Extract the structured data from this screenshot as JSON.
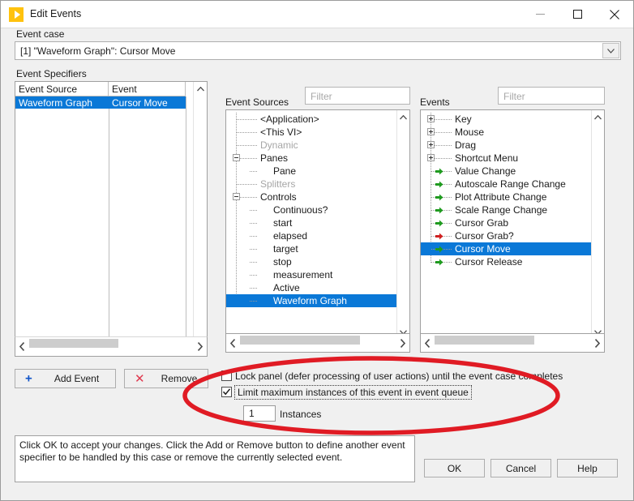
{
  "window": {
    "title": "Edit Events",
    "icon": "labview-run-icon",
    "controls": [
      {
        "name": "minimize-button",
        "glyph": "minimize-icon"
      },
      {
        "name": "maximize-button",
        "glyph": "maximize-icon"
      },
      {
        "name": "close-button",
        "glyph": "close-icon"
      }
    ]
  },
  "event_case": {
    "label": "Event case",
    "value": "[1] \"Waveform Graph\": Cursor Move",
    "dropdown_icon": "chevron-down-icon"
  },
  "event_specifiers": {
    "label": "Event Specifiers",
    "columns": [
      "Event Source",
      "Event"
    ],
    "rows": [
      {
        "source": "Waveform Graph",
        "event": "Cursor Move",
        "selected": true
      }
    ]
  },
  "event_sources": {
    "label": "Event Sources",
    "filter_placeholder": "Filter",
    "filter_value": "",
    "nodes": [
      {
        "label": "<Application>",
        "depth": 1,
        "expander": "none",
        "dim": false,
        "selected": false
      },
      {
        "label": "<This VI>",
        "depth": 1,
        "expander": "none",
        "dim": false,
        "selected": false
      },
      {
        "label": "Dynamic",
        "depth": 1,
        "expander": "none",
        "dim": true,
        "selected": false
      },
      {
        "label": "Panes",
        "depth": 1,
        "expander": "minus",
        "dim": false,
        "selected": false
      },
      {
        "label": "Pane",
        "depth": 2,
        "expander": "none",
        "dim": false,
        "selected": false
      },
      {
        "label": "Splitters",
        "depth": 1,
        "expander": "none",
        "dim": true,
        "selected": false
      },
      {
        "label": "Controls",
        "depth": 1,
        "expander": "minus",
        "dim": false,
        "selected": false
      },
      {
        "label": "Continuous?",
        "depth": 2,
        "expander": "none",
        "dim": false,
        "selected": false
      },
      {
        "label": "start",
        "depth": 2,
        "expander": "none",
        "dim": false,
        "selected": false
      },
      {
        "label": "elapsed",
        "depth": 2,
        "expander": "none",
        "dim": false,
        "selected": false
      },
      {
        "label": "target",
        "depth": 2,
        "expander": "none",
        "dim": false,
        "selected": false
      },
      {
        "label": "stop",
        "depth": 2,
        "expander": "none",
        "dim": false,
        "selected": false
      },
      {
        "label": "measurement",
        "depth": 2,
        "expander": "none",
        "dim": false,
        "selected": false
      },
      {
        "label": "Active",
        "depth": 2,
        "expander": "none",
        "dim": false,
        "selected": false
      },
      {
        "label": "Waveform Graph",
        "depth": 2,
        "expander": "none",
        "dim": false,
        "selected": true
      }
    ]
  },
  "events": {
    "label": "Events",
    "filter_placeholder": "Filter",
    "filter_value": "",
    "nodes": [
      {
        "label": "Key",
        "depth": 1,
        "expander": "plus",
        "arrow": "none",
        "selected": false
      },
      {
        "label": "Mouse",
        "depth": 1,
        "expander": "plus",
        "arrow": "none",
        "selected": false
      },
      {
        "label": "Drag",
        "depth": 1,
        "expander": "plus",
        "arrow": "none",
        "selected": false
      },
      {
        "label": "Shortcut Menu",
        "depth": 1,
        "expander": "plus",
        "arrow": "none",
        "selected": false
      },
      {
        "label": "Value Change",
        "depth": 1,
        "expander": "none",
        "arrow": "green",
        "selected": false
      },
      {
        "label": "Autoscale Range Change",
        "depth": 1,
        "expander": "none",
        "arrow": "green",
        "selected": false
      },
      {
        "label": "Plot Attribute Change",
        "depth": 1,
        "expander": "none",
        "arrow": "green",
        "selected": false
      },
      {
        "label": "Scale Range Change",
        "depth": 1,
        "expander": "none",
        "arrow": "green",
        "selected": false
      },
      {
        "label": "Cursor Grab",
        "depth": 1,
        "expander": "none",
        "arrow": "green",
        "selected": false
      },
      {
        "label": "Cursor Grab?",
        "depth": 1,
        "expander": "none",
        "arrow": "red",
        "selected": false
      },
      {
        "label": "Cursor Move",
        "depth": 1,
        "expander": "none",
        "arrow": "green",
        "selected": true
      },
      {
        "label": "Cursor Release",
        "depth": 1,
        "expander": "none",
        "arrow": "green",
        "selected": false
      }
    ]
  },
  "actions": {
    "add_event": "Add Event",
    "add_icon": "plus-icon",
    "remove": "Remove",
    "remove_icon": "x-icon"
  },
  "options": {
    "lock_panel": {
      "label": "Lock panel (defer processing of user actions) until the event case completes",
      "checked": false
    },
    "limit_instances": {
      "label": "Limit maximum instances of this event in event queue",
      "checked": true,
      "focused": true
    },
    "instances": {
      "value": "1",
      "label": "Instances"
    }
  },
  "help_text": "Click OK to accept your changes.  Click the Add or Remove button to define another event specifier to be handled by this case or remove the currently selected event.",
  "footer": {
    "ok": "OK",
    "cancel": "Cancel",
    "help": "Help"
  },
  "annotation": {
    "shape": "red-ellipse-highlight",
    "color": "#e01b24"
  },
  "colors": {
    "selection": "#0a78d7",
    "notify_arrow": "#1f9b1f",
    "filter_arrow": "#d02020",
    "accent": "#ffc20e"
  }
}
